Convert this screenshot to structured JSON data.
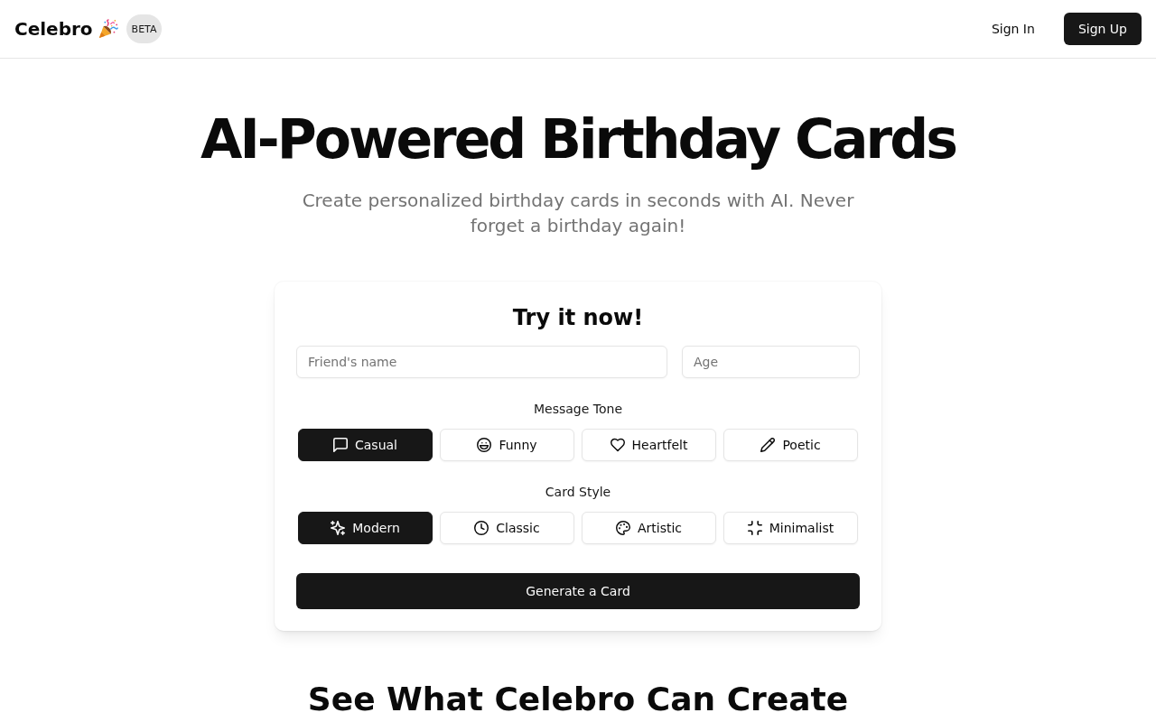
{
  "header": {
    "logo": "Celebro",
    "badge": "BETA",
    "sign_in": "Sign In",
    "sign_up": "Sign Up"
  },
  "hero": {
    "title": "AI-Powered Birthday Cards",
    "subtitle": "Create personalized birthday cards in seconds with AI. Never forget a birthday again!"
  },
  "form": {
    "title": "Try it now!",
    "name_field": {
      "placeholder": "Friend's name"
    },
    "age_field": {
      "placeholder": "Age"
    },
    "tone": {
      "label": "Message Tone",
      "options": [
        {
          "label": "Casual",
          "selected": true
        },
        {
          "label": "Funny",
          "selected": false
        },
        {
          "label": "Heartfelt",
          "selected": false
        },
        {
          "label": "Poetic",
          "selected": false
        }
      ]
    },
    "style": {
      "label": "Card Style",
      "options": [
        {
          "label": "Modern",
          "selected": true
        },
        {
          "label": "Classic",
          "selected": false
        },
        {
          "label": "Artistic",
          "selected": false
        },
        {
          "label": "Minimalist",
          "selected": false
        }
      ]
    },
    "submit": "Generate a Card"
  },
  "showcase": {
    "title": "See What Celebro Can Create"
  }
}
